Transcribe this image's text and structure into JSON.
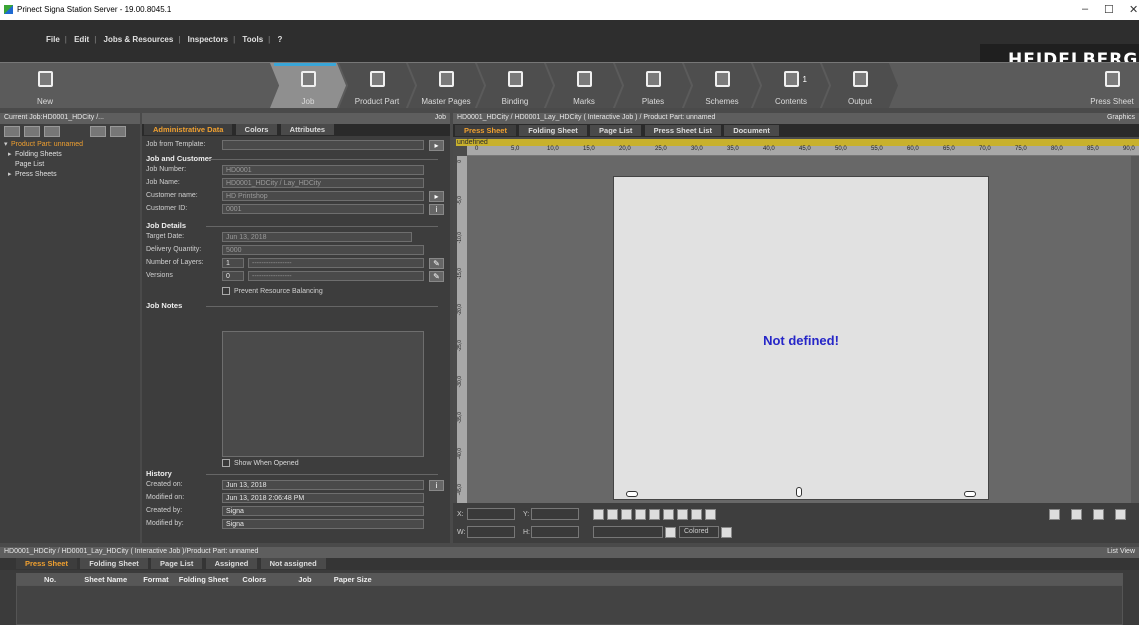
{
  "window": {
    "title": "Prinect Signa Station Server - 19.00.8045.1",
    "minimize": "–",
    "maximize": "☐",
    "close": "✕"
  },
  "menu": {
    "items": [
      "File",
      "Edit",
      "Jobs & Resources",
      "Inspectors",
      "Tools",
      "?"
    ],
    "separator": "|"
  },
  "brand": {
    "logo": "HEIDELBERG"
  },
  "toolbar": {
    "new_label": "New",
    "steps": [
      {
        "label": "Job",
        "icon": "job-icon"
      },
      {
        "label": "Product Part",
        "icon": "product-part-icon"
      },
      {
        "label": "Master Pages",
        "icon": "master-pages-icon"
      },
      {
        "label": "Binding",
        "icon": "binding-icon"
      },
      {
        "label": "Marks",
        "icon": "marks-icon"
      },
      {
        "label": "Plates",
        "icon": "plates-icon"
      },
      {
        "label": "Schemes",
        "icon": "schemes-icon"
      },
      {
        "label": "Contents",
        "icon": "contents-icon",
        "badge": "1"
      },
      {
        "label": "Output",
        "icon": "output-icon"
      }
    ],
    "press_sheet_label": "Press Sheet"
  },
  "left": {
    "header": "Current Job:HD0001_HDCity /...",
    "tree": {
      "root": "Product Part: unnamed",
      "children": [
        "Folding Sheets",
        "Page List",
        "Press Sheets"
      ]
    }
  },
  "mid": {
    "header_right": "Job",
    "tabs": [
      "Administrative Data",
      "Colors",
      "Attributes"
    ],
    "job_from_template_label": "Job from Template:",
    "sections": {
      "job_customer": "Job and Customer",
      "job_details": "Job Details",
      "job_notes": "Job Notes",
      "history": "History"
    },
    "fields": {
      "job_number": {
        "label": "Job Number:",
        "value": "HD0001"
      },
      "job_name": {
        "label": "Job Name:",
        "value": "HD0001_HDCity / Lay_HDCity"
      },
      "customer_name": {
        "label": "Customer name:",
        "value": "HD Printshop"
      },
      "customer_id": {
        "label": "Customer ID:",
        "value": "0001"
      },
      "target_date": {
        "label": "Target Date:",
        "value": "Jun 13, 2018"
      },
      "delivery_quantity": {
        "label": "Delivery Quantity:",
        "value": "5000"
      },
      "number_of_layers": {
        "label": "Number of Layers:",
        "value": "1",
        "dropdown": "-----------------"
      },
      "versions": {
        "label": "Versions",
        "value": "0",
        "dropdown": "-----------------"
      },
      "created_on": {
        "label": "Created on:",
        "value": "Jun 13, 2018"
      },
      "modified_on": {
        "label": "Modified on:",
        "value": "Jun 13, 2018  2:06:48 PM"
      },
      "created_by": {
        "label": "Created by:",
        "value": "Signa"
      },
      "modified_by": {
        "label": "Modified by:",
        "value": "Signa"
      }
    },
    "prevent_balancing": "Prevent Resource Balancing",
    "show_when_opened": "Show When Opened"
  },
  "right": {
    "header": "HD0001_HDCity / HD0001_Lay_HDCity ( Interactive Job ) / Product Part: unnamed",
    "header_right": "Graphics",
    "tabs": [
      "Press Sheet",
      "Folding Sheet",
      "Page List",
      "Press Sheet List",
      "Document"
    ],
    "undefined_label": "undefined",
    "ruler_ticks": [
      "0",
      "5,0",
      "10,0",
      "15,0",
      "20,0",
      "25,0",
      "30,0",
      "35,0",
      "40,0",
      "45,0",
      "50,0",
      "55,0",
      "60,0",
      "65,0",
      "70,0",
      "75,0",
      "80,0",
      "85,0",
      "90,0"
    ],
    "ruler_left_ticks": [
      "0",
      "-5,0",
      "-10,0",
      "-15,0",
      "-20,0",
      "-25,0",
      "-30,0",
      "-35,0",
      "-40,0",
      "-45,0"
    ],
    "sheet_message": "Not defined!",
    "coords": {
      "x": "X:",
      "y": "Y:",
      "w": "W:",
      "h": "H:"
    },
    "color_mode": "Colored"
  },
  "bottom": {
    "header": "HD0001_HDCity / HD0001_Lay_HDCity ( Interactive Job )/Product Part: unnamed",
    "header_right": "List View",
    "tabs": [
      "Press Sheet",
      "Folding Sheet",
      "Page List",
      "Assigned",
      "Not assigned"
    ],
    "columns": [
      "No.",
      "Sheet Name",
      "Format",
      "Folding Sheet",
      "Colors",
      "Job",
      "Paper Size"
    ]
  }
}
